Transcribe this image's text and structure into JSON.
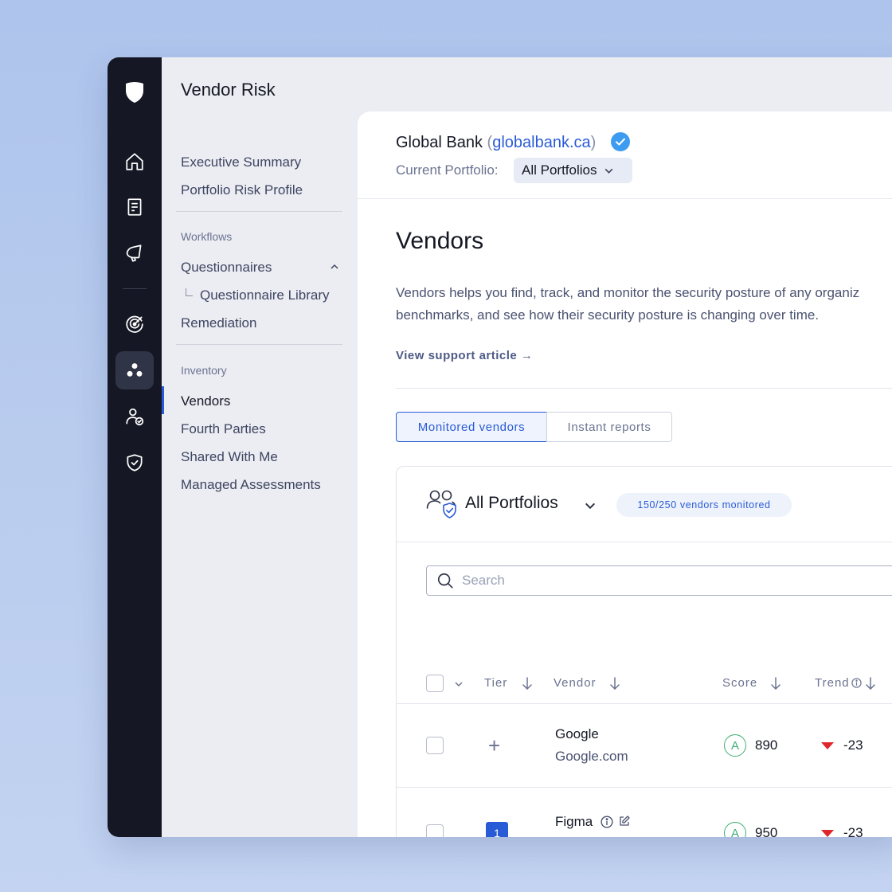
{
  "app": {
    "section_title": "Vendor Risk"
  },
  "rail": {
    "items": [
      {
        "icon": "home-icon"
      },
      {
        "icon": "document-icon"
      },
      {
        "icon": "megaphone-icon"
      },
      {
        "icon": "target-icon"
      },
      {
        "icon": "vendor-network-icon",
        "active": true
      },
      {
        "icon": "user-check-icon"
      },
      {
        "icon": "shield-check-icon"
      }
    ]
  },
  "nav": {
    "items_top": [
      "Executive Summary",
      "Portfolio Risk Profile"
    ],
    "workflows_label": "Workflows",
    "questionnaires": "Questionnaires",
    "questionnaire_library": "Questionnaire Library",
    "remediation": "Remediation",
    "inventory_label": "Inventory",
    "vendors": "Vendors",
    "fourth_parties": "Fourth Parties",
    "shared_with_me": "Shared With Me",
    "managed_assessments": "Managed Assessments"
  },
  "header": {
    "org_name": "Global Bank",
    "paren_open": "(",
    "org_domain": "globalbank.ca",
    "paren_close": ")",
    "portfolio_label": "Current Portfolio:",
    "portfolio_value": "All Portfolios"
  },
  "page": {
    "title": "Vendors",
    "description_line1": "Vendors helps you find, track, and monitor the security posture of any organiz",
    "description_line2": "benchmarks, and see how their security posture is changing over time.",
    "support_link": "View support article →",
    "tabs": [
      "Monitored vendors",
      "Instant reports"
    ]
  },
  "card": {
    "title": "All Portfolios",
    "badge": "150/250 vendors monitored",
    "search_placeholder": "Search"
  },
  "table": {
    "columns": [
      "Tier",
      "Vendor",
      "Score",
      "Trend"
    ],
    "rows": [
      {
        "tier": "+",
        "name": "Google",
        "domain": "Google.com",
        "grade": "A",
        "score": "890",
        "trend": "-23"
      },
      {
        "tier": "1",
        "name": "Figma",
        "domain": "",
        "grade": "A",
        "score": "950",
        "trend": "-23"
      }
    ]
  },
  "colors": {
    "accent": "#2a5bd7",
    "rail_bg": "#151824",
    "grade_good": "#3fae73",
    "trend_down": "#e0262b"
  }
}
